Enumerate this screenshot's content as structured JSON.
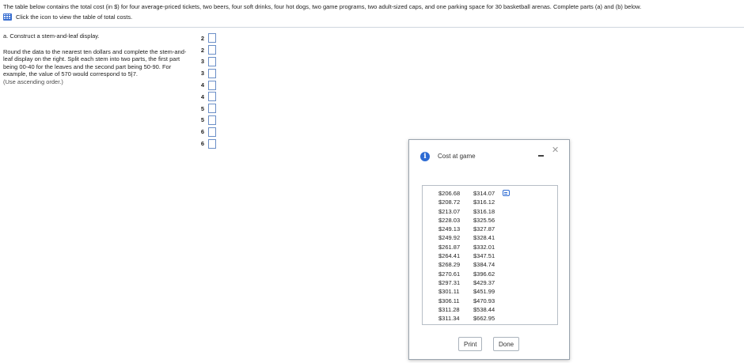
{
  "question": {
    "intro": "The table below contains the total cost (in $) for four average-priced tickets, two beers, four soft drinks, four hot dogs, two game programs, two adult-sized caps, and one parking space for 30 basketball arenas. Complete parts (a) and (b) below.",
    "table_link_text": "Click the icon to view the table of total costs.",
    "icons": {
      "table": "table-icon"
    }
  },
  "part_a": {
    "heading": "a. Construct a stem-and-leaf display.",
    "instruction": "Round the data to the nearest ten dollars and complete the stem-and-leaf display on the right. Split each stem into two parts, the first part being 00-40 for the leaves and the second part being 50-90. For example, the value of 570 would correspond to 5|7.",
    "hint": "(Use ascending order.)",
    "stems": [
      "2",
      "2",
      "3",
      "3",
      "4",
      "4",
      "5",
      "5",
      "6",
      "6"
    ],
    "leaves": [
      "",
      "",
      "",
      "",
      "",
      "",
      "",
      "",
      "",
      ""
    ]
  },
  "dialog": {
    "title": "Cost at game",
    "info_icon": "info-icon",
    "columns": [
      [
        "$206.68",
        "$208.72",
        "$213.07",
        "$228.03",
        "$249.13",
        "$249.92",
        "$261.87",
        "$264.41",
        "$268.29",
        "$270.61",
        "$297.31",
        "$301.11",
        "$306.11",
        "$311.28",
        "$311.34"
      ],
      [
        "$314.07",
        "$316.12",
        "$316.18",
        "$325.56",
        "$327.87",
        "$328.41",
        "$332.01",
        "$347.51",
        "$384.74",
        "$396.62",
        "$429.37",
        "$451.99",
        "$470.93",
        "$538.44",
        "$662.95"
      ]
    ],
    "print_label": "Print",
    "done_label": "Done",
    "colors": {
      "accent": "#2d6bd3"
    }
  }
}
